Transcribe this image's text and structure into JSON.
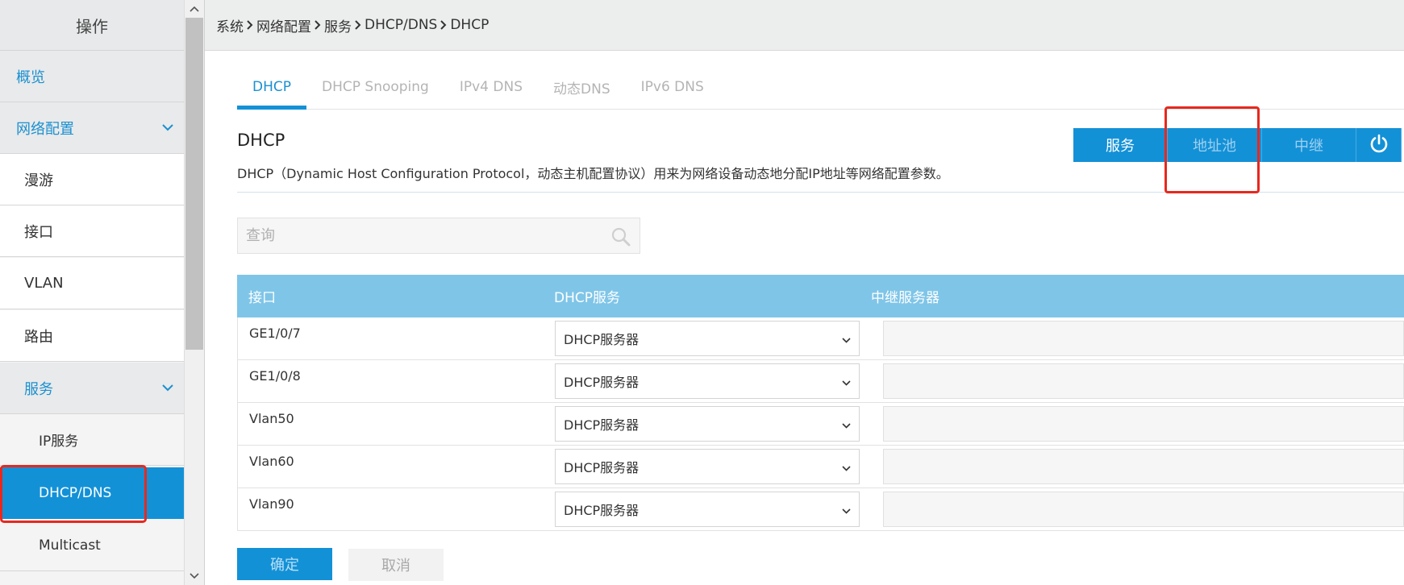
{
  "sidebar": {
    "header": "操作",
    "items": [
      {
        "label": "概览"
      },
      {
        "label": "网络配置"
      },
      {
        "label": "漫游"
      },
      {
        "label": "接口"
      },
      {
        "label": "VLAN"
      },
      {
        "label": "路由"
      },
      {
        "label": "服务"
      },
      {
        "label": "IP服务"
      },
      {
        "label": "DHCP/DNS"
      },
      {
        "label": "Multicast"
      }
    ]
  },
  "breadcrumb": [
    "系统",
    "网络配置",
    "服务",
    "DHCP/DNS",
    "DHCP"
  ],
  "tabs": [
    {
      "label": "DHCP"
    },
    {
      "label": "DHCP Snooping"
    },
    {
      "label": "IPv4 DNS"
    },
    {
      "label": "动态DNS"
    },
    {
      "label": "IPv6 DNS"
    }
  ],
  "section": {
    "title": "DHCP",
    "description": "DHCP（Dynamic Host Configuration Protocol，动态主机配置协议）用来为网络设备动态地分配IP地址等网络配置参数。"
  },
  "mode_buttons": {
    "service": "服务",
    "pool": "地址池",
    "relay": "中继"
  },
  "search": {
    "placeholder": "查询",
    "value": ""
  },
  "table": {
    "headers": [
      "接口",
      "DHCP服务",
      "中继服务器"
    ],
    "rows": [
      {
        "interface": "GE1/0/7",
        "service": "DHCP服务器",
        "relay": ""
      },
      {
        "interface": "GE1/0/8",
        "service": "DHCP服务器",
        "relay": ""
      },
      {
        "interface": "Vlan50",
        "service": "DHCP服务器",
        "relay": ""
      },
      {
        "interface": "Vlan60",
        "service": "DHCP服务器",
        "relay": ""
      },
      {
        "interface": "Vlan90",
        "service": "DHCP服务器",
        "relay": ""
      }
    ]
  },
  "actions": {
    "ok": "确定",
    "cancel": "取消"
  },
  "colors": {
    "accent": "#1391d7",
    "table_header": "#7fc5e8",
    "highlight": "#e8281e"
  }
}
